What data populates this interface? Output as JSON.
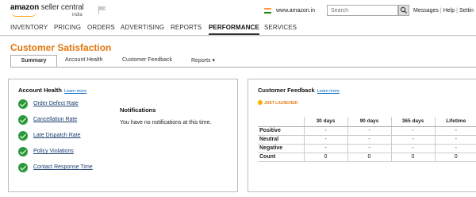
{
  "header": {
    "logo_main": "amazon",
    "logo_sub": " seller central",
    "logo_region": "india",
    "site": "www.amazon.in",
    "search_placeholder": "Search",
    "links": [
      "Messages",
      "Help",
      "Settin"
    ]
  },
  "nav": {
    "items": [
      "INVENTORY",
      "PRICING",
      "ORDERS",
      "ADVERTISING",
      "REPORTS",
      "PERFORMANCE",
      "SERVICES"
    ],
    "active": "PERFORMANCE"
  },
  "page": {
    "title": "Customer Satisfaction",
    "tabs": [
      "Summary",
      "Account Health",
      "Customer Feedback",
      "Reports ▾"
    ]
  },
  "account_health": {
    "title": "Account Health",
    "learn_more": "Learn more",
    "metrics": [
      "Order Defect Rate",
      "Cancellation Rate",
      "Late Dispatch Rate",
      "Policy Violations",
      "Contact Response Time"
    ],
    "notifications_title": "Notifications",
    "notifications_text": "You have no notifications at this time."
  },
  "customer_feedback": {
    "title": "Customer Feedback",
    "learn_more": "Learn more",
    "badge": "JUST LAUNCHED",
    "columns": [
      "",
      "30 days",
      "90 days",
      "365 days",
      "Lifetime"
    ],
    "rows": [
      [
        "Positive",
        "-",
        "-",
        "-",
        "-"
      ],
      [
        "Neutral",
        "-",
        "-",
        "-",
        "-"
      ],
      [
        "Negative",
        "-",
        "-",
        "-",
        "-"
      ],
      [
        "Count",
        "0",
        "0",
        "0",
        "0"
      ]
    ]
  },
  "colors": {
    "accent": "#e47911",
    "link": "#0066c0",
    "check": "#2a9a3a"
  }
}
